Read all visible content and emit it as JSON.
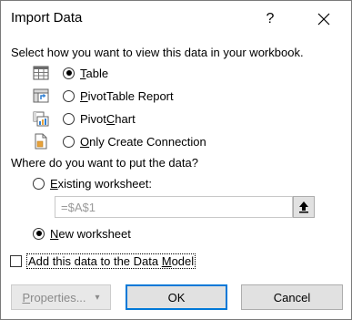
{
  "window": {
    "title": "Import Data",
    "help_label": "?"
  },
  "view_section": {
    "prompt": "Select how you want to view this data in your workbook.",
    "options": [
      {
        "mnemonic": "T",
        "rest": "able",
        "icon": "table-icon",
        "checked": true
      },
      {
        "mnemonic": "P",
        "rest": "ivotTable Report",
        "icon": "pivottable-report-icon",
        "checked": false
      },
      {
        "pre": "Pivot",
        "mnemonic": "C",
        "rest": "hart",
        "icon": "pivotchart-icon",
        "checked": false
      },
      {
        "mnemonic": "O",
        "rest": "nly Create Connection",
        "icon": "connection-icon",
        "checked": false
      }
    ]
  },
  "location_section": {
    "prompt": "Where do you want to put the data?",
    "existing": {
      "mnemonic": "E",
      "rest": "xisting worksheet:",
      "checked": false
    },
    "cell_value": "=$A$1",
    "new": {
      "mnemonic": "N",
      "rest": "ew worksheet",
      "checked": true
    }
  },
  "data_model": {
    "pre": "Add this data to the Data ",
    "mnemonic": "M",
    "rest": "odel",
    "checked": false
  },
  "buttons": {
    "properties_pre": "P",
    "properties_rest": "roperties...",
    "properties_arrow": "▾",
    "ok": "OK",
    "cancel": "Cancel"
  },
  "colors": {
    "accent": "#0078d7",
    "icon_blue": "#2f7fd4",
    "icon_orange": "#e8a23b"
  }
}
